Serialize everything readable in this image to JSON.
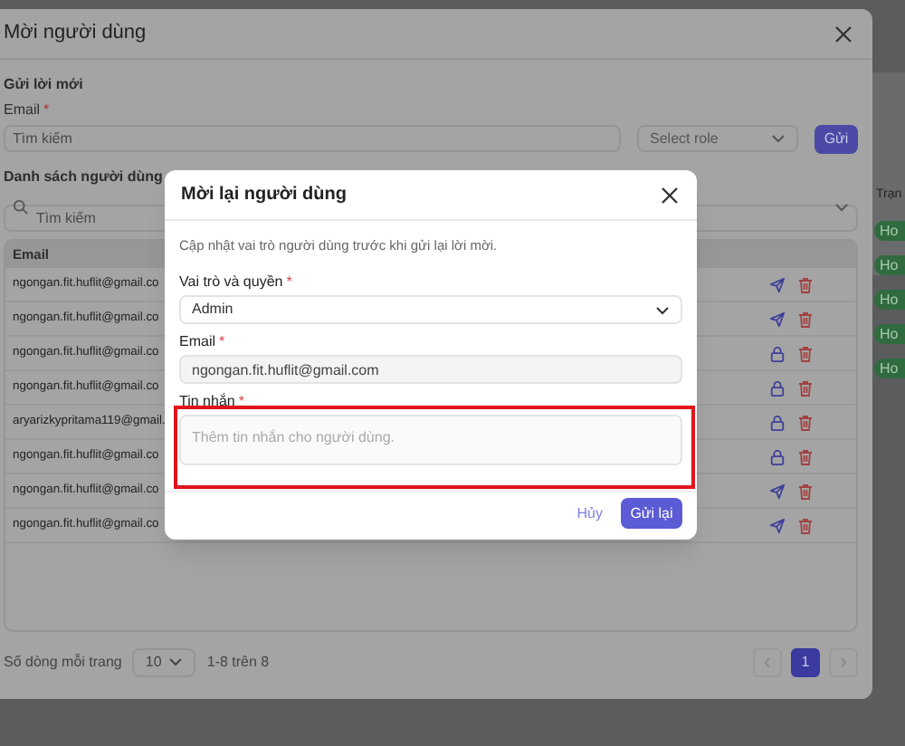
{
  "background": {
    "column_header": "Trạn",
    "badges": [
      "Ho",
      "Ho",
      "Ho",
      "Ho",
      "Ho"
    ]
  },
  "invite_dialog": {
    "title": "Mời người dùng",
    "section_title": "Gửi lời mới",
    "email_field": {
      "label": "Email",
      "mark": "*",
      "placeholder": "Tìm kiếm"
    },
    "role_select": {
      "placeholder": "Select role"
    },
    "send_button": "Gửi",
    "list_title": "Danh sách người dùng",
    "search": {
      "placeholder": "Tìm kiếm"
    },
    "table": {
      "columns": [
        "Email"
      ],
      "rows": [
        {
          "email": "ngongan.fit.huflit@gmail.co",
          "kind": "send"
        },
        {
          "email": "ngongan.fit.huflit@gmail.co",
          "kind": "send"
        },
        {
          "email": "ngongan.fit.huflit@gmail.co",
          "kind": "lock"
        },
        {
          "email": "ngongan.fit.huflit@gmail.co",
          "kind": "lock"
        },
        {
          "email": "aryarizkypritama119@gmail.",
          "kind": "lock"
        },
        {
          "email": "ngongan.fit.huflit@gmail.co",
          "kind": "lock"
        },
        {
          "email": "ngongan.fit.huflit@gmail.co",
          "kind": "send"
        },
        {
          "email": "ngongan.fit.huflit@gmail.co",
          "kind": "send"
        }
      ]
    },
    "footer": {
      "rows_per_page_label": "Số dòng mỗi trang",
      "rows_per_page": "10",
      "range": "1-8 trên 8",
      "pages": [
        {
          "label": "1",
          "selected": true
        }
      ]
    }
  },
  "reinvite_dialog": {
    "title": "Mời lại người dùng",
    "description": "Cập nhật vai trò người dùng trước khi gửi lại lời mời.",
    "role_field": {
      "label": "Vai trò và quyền",
      "mark": "*",
      "value": "Admin"
    },
    "email_field": {
      "label": "Email",
      "mark": "*",
      "value": "ngongan.fit.huflit@gmail.com"
    },
    "message_field": {
      "label": "Tin nhắn",
      "mark": "*",
      "placeholder": "Thêm tin nhắn cho người dùng.",
      "highlighted": true
    },
    "cancel_button": "Hủy",
    "resend_button": "Gửi lại"
  }
}
